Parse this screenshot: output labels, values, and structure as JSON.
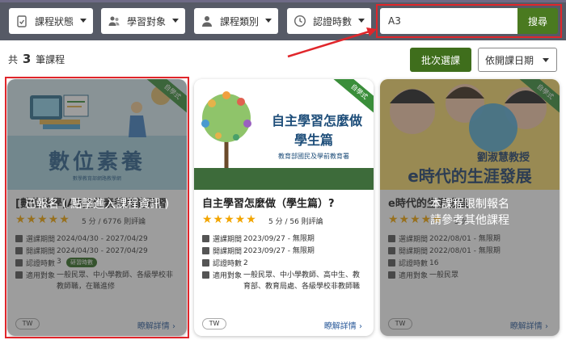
{
  "filters": {
    "status": "課程狀態",
    "audience": "學習對象",
    "category": "課程類別",
    "hours": "認證時數",
    "search_value": "A3",
    "search_btn": "搜尋"
  },
  "results": {
    "prefix": "共",
    "count": "3",
    "suffix": "筆課程",
    "batch_btn": "批次選課",
    "sort": "依開課日期"
  },
  "cards": [
    {
      "ribbon": "自學式",
      "thumb_text": "數位素養",
      "thumb_sub": "數學教育部網路教學網",
      "title": "[數位教學]A3數位素養增能研習",
      "stars": "★★★★★",
      "rating": "5 分 / 6776 則評論",
      "select_label": "選課期間",
      "select_value": "2024/04/30 - 2027/04/29",
      "open_label": "開課期間",
      "open_value": "2024/04/30 - 2027/04/29",
      "hours_label": "認證時數",
      "hours_value": "3",
      "hours_badge": "研習時數",
      "target_label": "適用對象",
      "target_value": "一般民眾、中小學教師、各級學校非教師職，在職進修",
      "tw": "TW",
      "detail": "瞭解詳情 ›",
      "overlay": "已報名 ( 點擊進入課程資訊 )"
    },
    {
      "ribbon": "自學式",
      "thumb_title": "自主學習怎麼做",
      "thumb_title2": "學生篇",
      "thumb_sub": "教育部國民及學前教育署",
      "title": "自主學習怎麼做（學生篇）?",
      "stars": "★★★★★",
      "rating": "5 分 / 56 則評論",
      "select_label": "選課期間",
      "select_value": "2023/09/27 - 無限期",
      "open_label": "開課期間",
      "open_value": "2023/09/27 - 無限期",
      "hours_label": "認證時數",
      "hours_value": "2",
      "target_label": "適用對象",
      "target_value": "一般民眾、中小學教師、高中生、教育部、教育局處、各級學校非教師職",
      "tw": "TW",
      "detail": "瞭解詳情 ›"
    },
    {
      "ribbon": "自學式",
      "thumb_text": "e時代的生涯發展",
      "thumb_sub": "劉淑慧教授",
      "title": "e時代的生涯發展",
      "stars": "★★★★★",
      "rating": "5 分",
      "select_label": "選課期間",
      "select_value": "2022/08/01 - 無限期",
      "open_label": "開課期間",
      "open_value": "2022/08/01 - 無限期",
      "hours_label": "認證時數",
      "hours_value": "16",
      "target_label": "適用對象",
      "target_value": "一般民眾",
      "tw": "TW",
      "detail": "瞭解詳情 ›",
      "overlay_line1": "本課程限制報名",
      "overlay_line2": "請參考其他課程"
    }
  ],
  "colors": {
    "filterbar": "#565a66",
    "search_btn": "#4a7a20",
    "highlight": "#e0262b",
    "star": "#f2a500"
  }
}
